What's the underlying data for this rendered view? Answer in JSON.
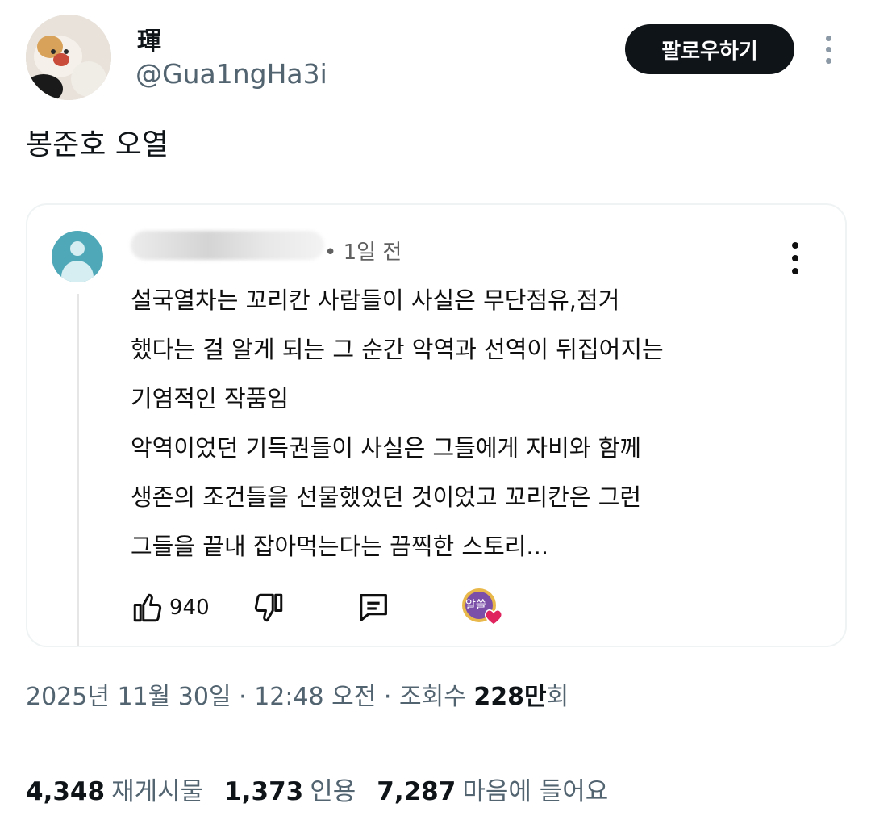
{
  "author": {
    "display_name": "琿",
    "handle": "@Gua1ngHa3i",
    "avatar_icon": "cat-photo-avatar"
  },
  "header": {
    "follow_label": "팔로우하기",
    "more_icon": "more-vertical-icon"
  },
  "tweet": {
    "text": "봉준호 오열"
  },
  "quote": {
    "avatar_icon": "default-user-avatar",
    "time_ago": "• 1일 전",
    "menu_icon": "kebab-menu-icon",
    "lines": [
      "설국열차는 꼬리칸 사람들이 사실은 무단점유,점거",
      "했다는 걸 알게 되는 그 순간 악역과 선역이 뒤집어지는",
      "기염적인 작품임",
      "악역이었던 기득권들이 사실은 그들에게 자비와 함께",
      "생존의 조건들을 선물했었던 것이었고 꼬리칸은 그런",
      "그들을 끝내 잡아먹는다는 끔찍한 스토리..."
    ],
    "like_count": "940",
    "badge_text": "알쓸"
  },
  "meta": {
    "date": "2025년 11월 30일",
    "sep1": " · ",
    "time": "12:48 오전",
    "sep2": " · ",
    "views_label": "조회수 ",
    "views_value": "228만",
    "views_suffix": "회"
  },
  "stats": {
    "retweets": "4,348",
    "retweets_label": "재게시물",
    "quotes": "1,373",
    "quotes_label": "인용",
    "likes": "7,287",
    "likes_label": "마음에 들어요"
  },
  "colors": {
    "text_primary": "#0f1419",
    "text_secondary": "#536471",
    "button_dark": "#0f1419",
    "card_border": "#eff3f4",
    "heart": "#e0245e"
  }
}
